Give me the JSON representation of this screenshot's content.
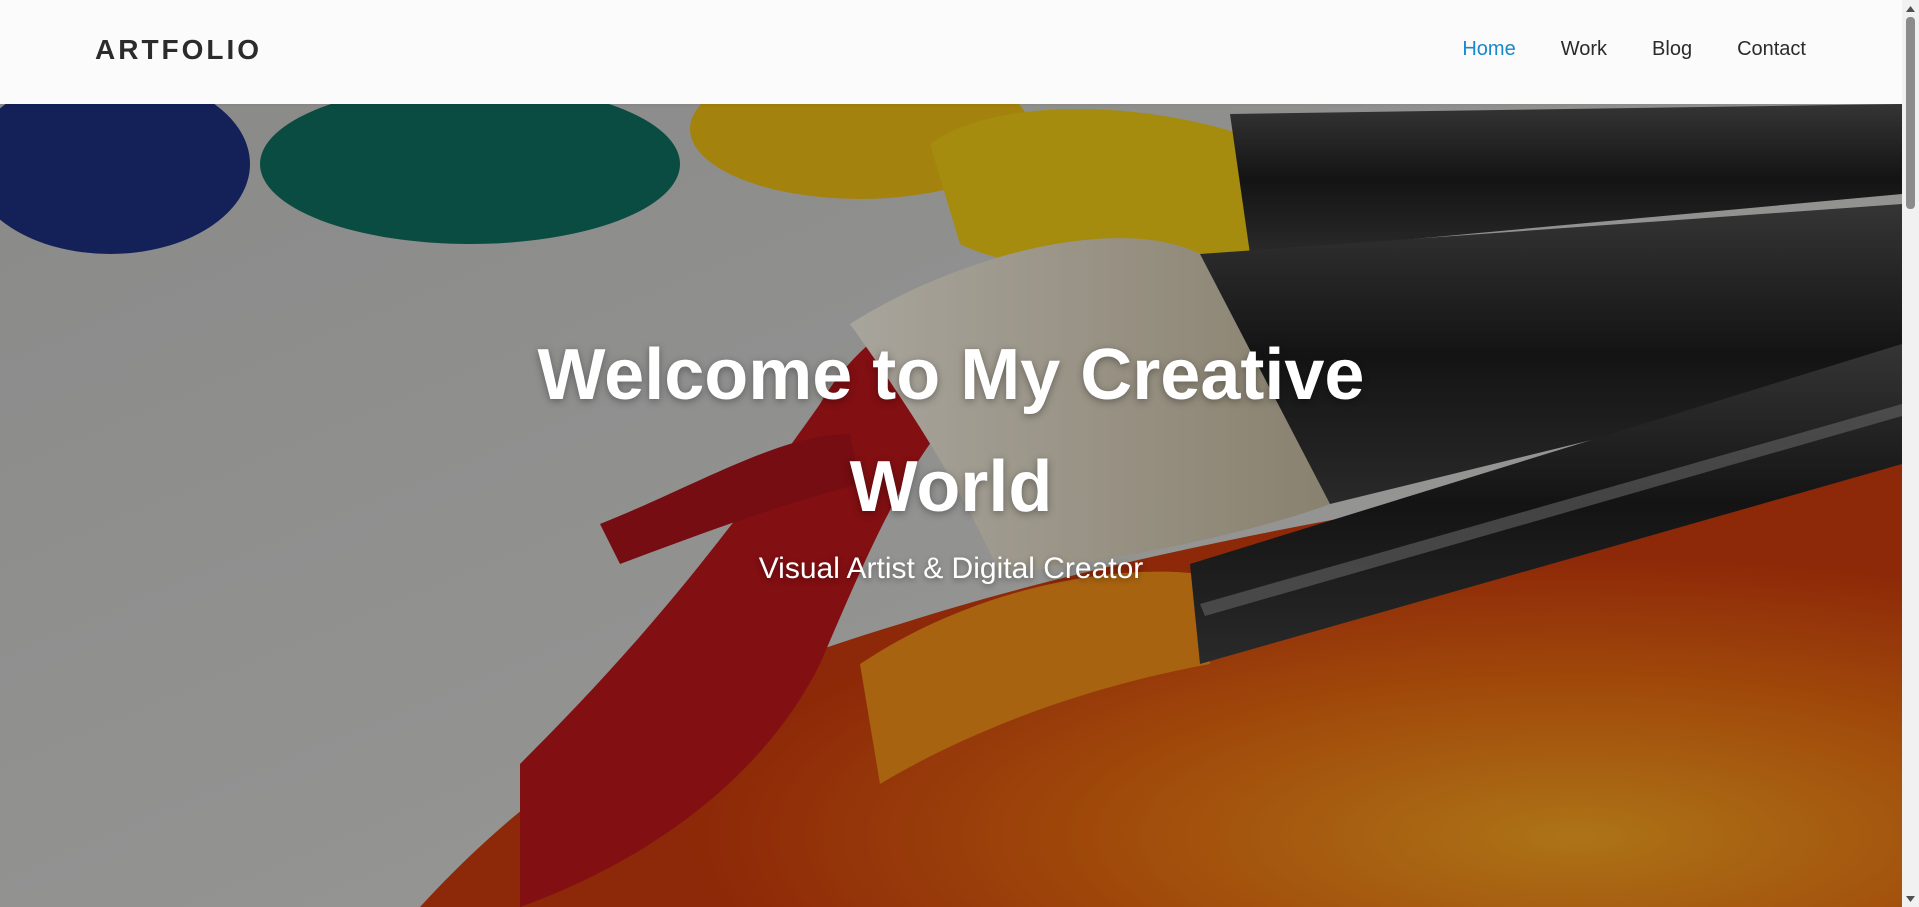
{
  "header": {
    "logo": "ARTFOLIO",
    "nav": [
      {
        "label": "Home",
        "active": true
      },
      {
        "label": "Work",
        "active": false
      },
      {
        "label": "Blog",
        "active": false
      },
      {
        "label": "Contact",
        "active": false
      }
    ]
  },
  "hero": {
    "title": "Welcome to My Creative World",
    "subtitle": "Visual Artist & Digital Creator",
    "background": "paint-brushes-photo"
  },
  "colors": {
    "accent": "#1a88c9",
    "nav_text": "#2b2b2b",
    "header_bg": "#fbfbfb"
  },
  "icons": {
    "scroll_up": "chevron-up-icon",
    "scroll_down": "chevron-down-icon"
  }
}
